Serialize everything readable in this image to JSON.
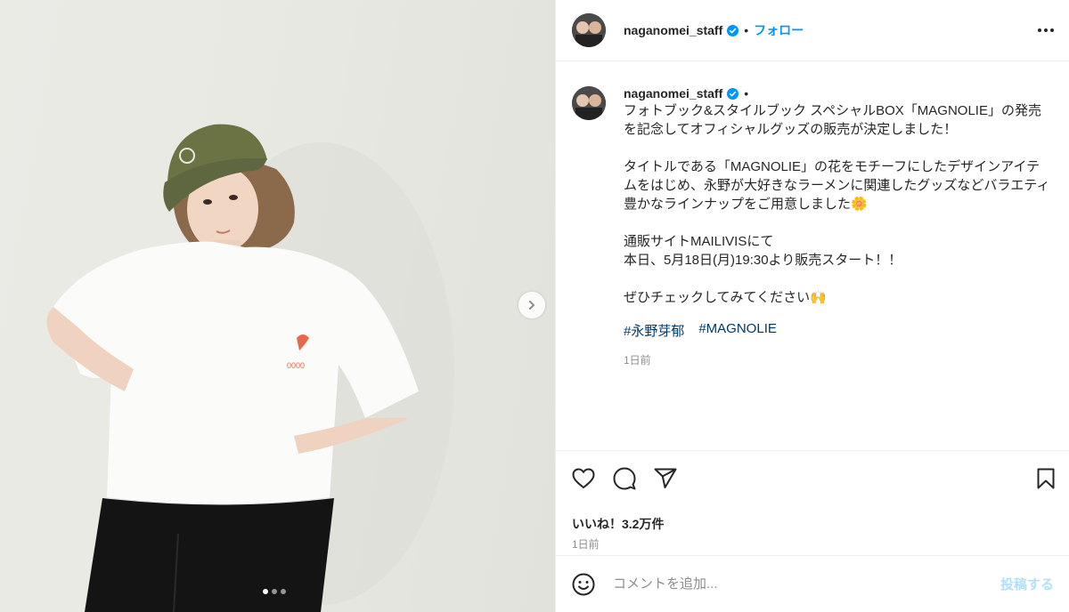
{
  "post": {
    "slide_count": 3,
    "active_slide": 1,
    "shirt_print_text": "0000"
  },
  "header": {
    "username": "naganomei_staff",
    "separator": "•",
    "follow_label": "フォロー",
    "more_icon": "more-horizontal-icon"
  },
  "caption": {
    "username": "naganomei_staff",
    "separator": "•",
    "text": "フォトブック&スタイルブック スペシャルBOX「MAGNOLIE」の発売を記念してオフィシャルグッズの販売が決定しました！\n\nタイトルである「MAGNOLIE」の花をモチーフにしたデザインアイテムをはじめ、永野が大好きなラーメンに関連したグッズなどバラエティ豊かなラインナップをご用意しました🌼\n\n通販サイトMAILIVISにて\n本日、5月18日(月)19:30より販売スタート！！\n\nぜひチェックしてみてください🙌",
    "hashtags": [
      "#永野芽郁",
      "#MAGNOLIE"
    ],
    "time": "1日前"
  },
  "actions": {
    "icons": [
      "heart-icon",
      "comment-icon",
      "share-icon",
      "bookmark-icon"
    ],
    "likes": "いいね！3.2万件",
    "time": "1日前"
  },
  "comment": {
    "placeholder": "コメントを追加...",
    "post_label": "投稿する"
  },
  "colors": {
    "accent": "#0095f6",
    "hashtag": "#00376b",
    "muted": "#8e8e8e",
    "post_disabled": "#b2dffc",
    "cap_green": "#6b7345"
  }
}
